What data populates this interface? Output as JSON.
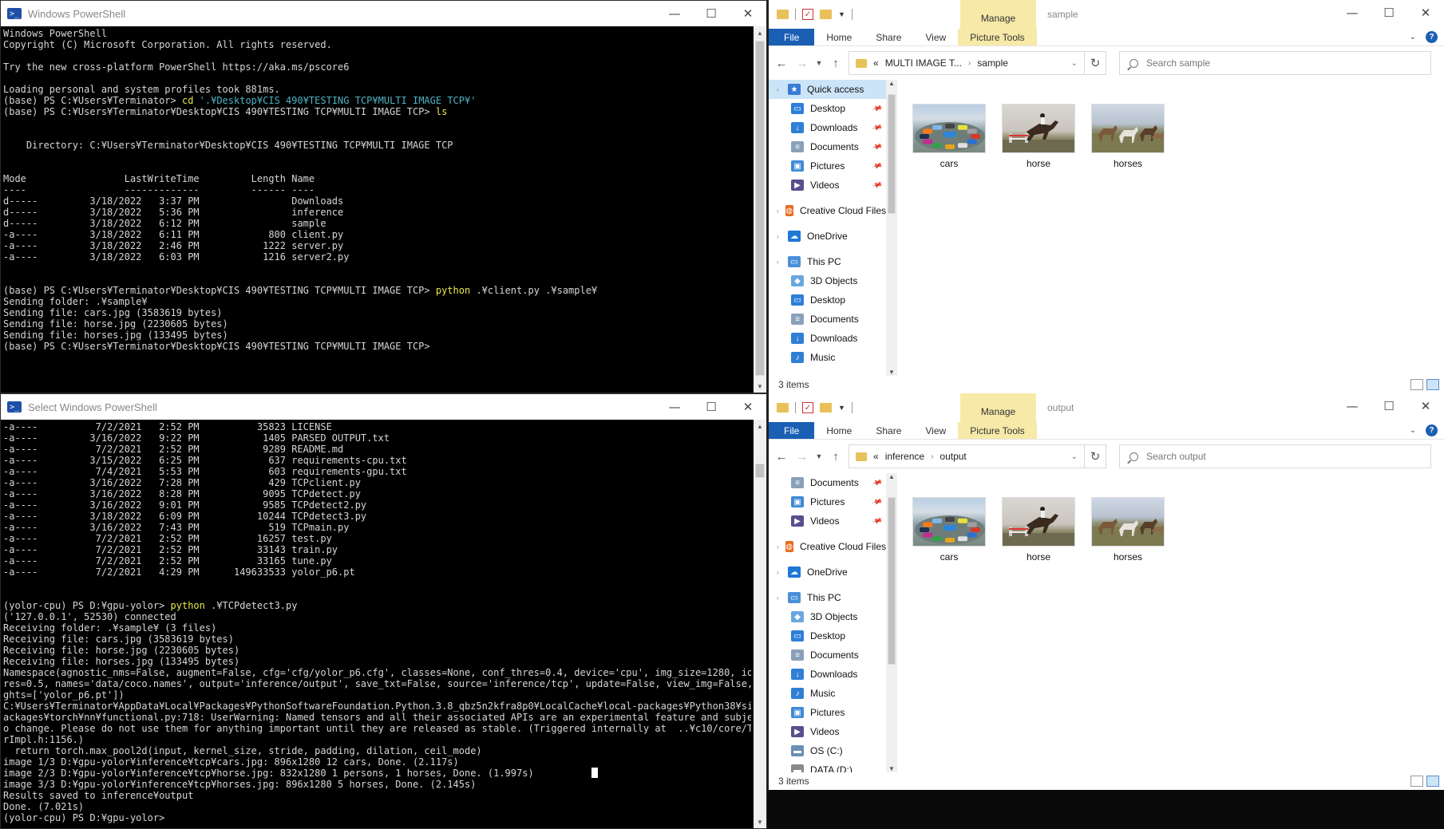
{
  "powershell_top": {
    "title": "Windows PowerShell",
    "lines": [
      [
        {
          "t": "Windows PowerShell",
          "c": "arg"
        }
      ],
      [
        {
          "t": "Copyright (C) Microsoft Corporation. All rights reserved.",
          "c": "arg"
        }
      ],
      [
        {
          "t": "",
          "c": "arg"
        }
      ],
      [
        {
          "t": "Try the new cross-platform PowerShell https://aka.ms/pscore6",
          "c": "arg"
        }
      ],
      [
        {
          "t": "",
          "c": "arg"
        }
      ],
      [
        {
          "t": "Loading personal and system profiles took 881ms.",
          "c": "arg"
        }
      ],
      [
        {
          "t": "(base) PS C:¥Users¥Terminator> ",
          "c": "arg"
        },
        {
          "t": "cd ",
          "c": "cmd"
        },
        {
          "t": "'.¥Desktop¥CIS 490¥TESTING TCP¥MULTI IMAGE TCP¥'",
          "c": "str"
        }
      ],
      [
        {
          "t": "(base) PS C:¥Users¥Terminator¥Desktop¥CIS 490¥TESTING TCP¥MULTI IMAGE TCP> ",
          "c": "arg"
        },
        {
          "t": "ls",
          "c": "cmd"
        }
      ],
      [
        {
          "t": "",
          "c": "arg"
        }
      ],
      [
        {
          "t": "",
          "c": "arg"
        }
      ],
      [
        {
          "t": "    Directory: C:¥Users¥Terminator¥Desktop¥CIS 490¥TESTING TCP¥MULTI IMAGE TCP",
          "c": "arg"
        }
      ],
      [
        {
          "t": "",
          "c": "arg"
        }
      ],
      [
        {
          "t": "",
          "c": "arg"
        }
      ],
      [
        {
          "t": "Mode                 LastWriteTime         Length Name",
          "c": "arg"
        }
      ],
      [
        {
          "t": "----                 -------------         ------ ----",
          "c": "arg"
        }
      ],
      [
        {
          "t": "d-----         3/18/2022   3:37 PM                Downloads",
          "c": "arg"
        }
      ],
      [
        {
          "t": "d-----         3/18/2022   5:36 PM                inference",
          "c": "arg"
        }
      ],
      [
        {
          "t": "d-----         3/18/2022   6:12 PM                sample",
          "c": "arg"
        }
      ],
      [
        {
          "t": "-a----         3/18/2022   6:11 PM            800 client.py",
          "c": "arg"
        }
      ],
      [
        {
          "t": "-a----         3/18/2022   2:46 PM           1222 server.py",
          "c": "arg"
        }
      ],
      [
        {
          "t": "-a----         3/18/2022   6:03 PM           1216 server2.py",
          "c": "arg"
        }
      ],
      [
        {
          "t": "",
          "c": "arg"
        }
      ],
      [
        {
          "t": "",
          "c": "arg"
        }
      ],
      [
        {
          "t": "(base) PS C:¥Users¥Terminator¥Desktop¥CIS 490¥TESTING TCP¥MULTI IMAGE TCP> ",
          "c": "arg"
        },
        {
          "t": "python",
          "c": "cmd"
        },
        {
          "t": " .¥client.py .¥sample¥",
          "c": "arg"
        }
      ],
      [
        {
          "t": "Sending folder: .¥sample¥",
          "c": "arg"
        }
      ],
      [
        {
          "t": "Sending file: cars.jpg (3583619 bytes)",
          "c": "arg"
        }
      ],
      [
        {
          "t": "Sending file: horse.jpg (2230605 bytes)",
          "c": "arg"
        }
      ],
      [
        {
          "t": "Sending file: horses.jpg (133495 bytes)",
          "c": "arg"
        }
      ],
      [
        {
          "t": "(base) PS C:¥Users¥Terminator¥Desktop¥CIS 490¥TESTING TCP¥MULTI IMAGE TCP>",
          "c": "arg"
        }
      ]
    ]
  },
  "powershell_bottom": {
    "title": "Select Windows PowerShell",
    "lines": [
      [
        {
          "t": "-a----          7/2/2021   2:52 PM          35823 LICENSE",
          "c": "arg"
        }
      ],
      [
        {
          "t": "-a----         3/16/2022   9:22 PM           1405 PARSED OUTPUT.txt",
          "c": "arg"
        }
      ],
      [
        {
          "t": "-a----          7/2/2021   2:52 PM           9289 README.md",
          "c": "arg"
        }
      ],
      [
        {
          "t": "-a----         3/15/2022   6:25 PM            637 requirements-cpu.txt",
          "c": "arg"
        }
      ],
      [
        {
          "t": "-a----          7/4/2021   5:53 PM            603 requirements-gpu.txt",
          "c": "arg"
        }
      ],
      [
        {
          "t": "-a----         3/16/2022   7:28 PM            429 TCPclient.py",
          "c": "arg"
        }
      ],
      [
        {
          "t": "-a----         3/16/2022   8:28 PM           9095 TCPdetect.py",
          "c": "arg"
        }
      ],
      [
        {
          "t": "-a----         3/16/2022   9:01 PM           9585 TCPdetect2.py",
          "c": "arg"
        }
      ],
      [
        {
          "t": "-a----         3/18/2022   6:09 PM          10244 TCPdetect3.py",
          "c": "arg"
        }
      ],
      [
        {
          "t": "-a----         3/16/2022   7:43 PM            519 TCPmain.py",
          "c": "arg"
        }
      ],
      [
        {
          "t": "-a----          7/2/2021   2:52 PM          16257 test.py",
          "c": "arg"
        }
      ],
      [
        {
          "t": "-a----          7/2/2021   2:52 PM          33143 train.py",
          "c": "arg"
        }
      ],
      [
        {
          "t": "-a----          7/2/2021   2:52 PM          33165 tune.py",
          "c": "arg"
        }
      ],
      [
        {
          "t": "-a----          7/2/2021   4:29 PM      149633533 yolor_p6.pt",
          "c": "arg"
        }
      ],
      [
        {
          "t": "",
          "c": "arg"
        }
      ],
      [
        {
          "t": "",
          "c": "arg"
        }
      ],
      [
        {
          "t": "(yolor-cpu) PS D:¥gpu-yolor> ",
          "c": "arg"
        },
        {
          "t": "python",
          "c": "cmd"
        },
        {
          "t": " .¥TCPdetect3.py",
          "c": "arg"
        }
      ],
      [
        {
          "t": "('127.0.0.1', 52530) connected",
          "c": "arg"
        }
      ],
      [
        {
          "t": "Receiving folder: .¥sample¥ (3 files)",
          "c": "arg"
        }
      ],
      [
        {
          "t": "Receiving file: cars.jpg (3583619 bytes)",
          "c": "arg"
        }
      ],
      [
        {
          "t": "Receiving file: horse.jpg (2230605 bytes)",
          "c": "arg"
        }
      ],
      [
        {
          "t": "Receiving file: horses.jpg (133495 bytes)",
          "c": "arg"
        }
      ],
      [
        {
          "t": "Namespace(agnostic_nms=False, augment=False, cfg='cfg/yolor_p6.cfg', classes=None, conf_thres=0.4, device='cpu', img_size=1280, iou_th",
          "c": "arg"
        }
      ],
      [
        {
          "t": "res=0.5, names='data/coco.names', output='inference/output', save_txt=False, source='inference/tcp', update=False, view_img=False, wei",
          "c": "arg"
        }
      ],
      [
        {
          "t": "ghts=['yolor_p6.pt'])",
          "c": "arg"
        }
      ],
      [
        {
          "t": "C:¥Users¥Terminator¥AppData¥Local¥Packages¥PythonSoftwareFoundation.Python.3.8_qbz5n2kfra8p0¥LocalCache¥local-packages¥Python38¥site-p",
          "c": "arg"
        }
      ],
      [
        {
          "t": "ackages¥torch¥nn¥functional.py:718: UserWarning: Named tensors and all their associated APIs are an experimental feature and subject t",
          "c": "arg"
        }
      ],
      [
        {
          "t": "o change. Please do not use them for anything important until they are released as stable. (Triggered internally at  ..¥c10/core/Tenso",
          "c": "arg"
        }
      ],
      [
        {
          "t": "rImpl.h:1156.)",
          "c": "arg"
        }
      ],
      [
        {
          "t": "  return torch.max_pool2d(input, kernel_size, stride, padding, dilation, ceil_mode)",
          "c": "arg"
        }
      ],
      [
        {
          "t": "image 1/3 D:¥gpu-yolor¥inference¥tcp¥cars.jpg: 896x1280 12 cars, Done. (2.117s)",
          "c": "arg"
        }
      ],
      [
        {
          "t": "image 2/3 D:¥gpu-yolor¥inference¥tcp¥horse.jpg: 832x1280 1 persons, 1 horses, Done. (1.997s)",
          "c": "arg"
        }
      ],
      [
        {
          "t": "image 3/3 D:¥gpu-yolor¥inference¥tcp¥horses.jpg: 896x1280 5 horses, Done. (2.145s)",
          "c": "arg"
        }
      ],
      [
        {
          "t": "Results saved to inference¥output",
          "c": "arg"
        }
      ],
      [
        {
          "t": "Done. (7.021s)",
          "c": "arg"
        }
      ],
      [
        {
          "t": "(yolor-cpu) PS D:¥gpu-yolor>",
          "c": "arg"
        }
      ]
    ]
  },
  "window_buttons": {
    "minimize": "—",
    "maximize": "☐",
    "close": "✕"
  },
  "explorer_top": {
    "title": "sample",
    "manage": "Manage",
    "tabs": [
      "File",
      "Home",
      "Share",
      "View",
      "Picture Tools"
    ],
    "breadcrumb": [
      "«",
      "MULTI IMAGE T...",
      "›",
      "sample"
    ],
    "search_placeholder": "Search sample",
    "nav": [
      {
        "label": "Quick access",
        "level": 0,
        "icon": "star-icon",
        "color": "#3a7bd5",
        "selected": true,
        "pin": false
      },
      {
        "label": "Desktop",
        "level": 1,
        "icon": "desktop-icon",
        "color": "#2f7fd6",
        "pin": true
      },
      {
        "label": "Downloads",
        "level": 1,
        "icon": "download-icon",
        "color": "#2f7fd6",
        "pin": true
      },
      {
        "label": "Documents",
        "level": 1,
        "icon": "document-icon",
        "color": "#8aa0b8",
        "pin": true
      },
      {
        "label": "Pictures",
        "level": 1,
        "icon": "picture-icon",
        "color": "#3f8ad6",
        "pin": true
      },
      {
        "label": "Videos",
        "level": 1,
        "icon": "video-icon",
        "color": "#5a4e8c",
        "pin": true
      },
      {
        "label": "Creative Cloud Files",
        "level": 0,
        "icon": "creative-cloud-icon",
        "color": "#e86a1a",
        "gap": true
      },
      {
        "label": "OneDrive",
        "level": 0,
        "icon": "onedrive-icon",
        "color": "#1e78d7",
        "gap": true
      },
      {
        "label": "This PC",
        "level": 0,
        "icon": "pc-icon",
        "color": "#4a90d9",
        "gap": true
      },
      {
        "label": "3D Objects",
        "level": 1,
        "icon": "3d-objects-icon",
        "color": "#6aa7e0"
      },
      {
        "label": "Desktop",
        "level": 1,
        "icon": "desktop-icon",
        "color": "#2f7fd6"
      },
      {
        "label": "Documents",
        "level": 1,
        "icon": "document-icon",
        "color": "#8aa0b8"
      },
      {
        "label": "Downloads",
        "level": 1,
        "icon": "download-icon",
        "color": "#2f7fd6"
      },
      {
        "label": "Music",
        "level": 1,
        "icon": "music-icon",
        "color": "#2f7fd6"
      }
    ],
    "files": [
      {
        "name": "cars",
        "kind": "cars"
      },
      {
        "name": "horse",
        "kind": "horse"
      },
      {
        "name": "horses",
        "kind": "horses"
      }
    ],
    "status": "3 items"
  },
  "explorer_bottom": {
    "title": "output",
    "manage": "Manage",
    "tabs": [
      "File",
      "Home",
      "Share",
      "View",
      "Picture Tools"
    ],
    "breadcrumb": [
      "«",
      "inference",
      "›",
      "output"
    ],
    "search_placeholder": "Search output",
    "nav": [
      {
        "label": "Documents",
        "level": 1,
        "icon": "document-icon",
        "color": "#8aa0b8",
        "pin": true
      },
      {
        "label": "Pictures",
        "level": 1,
        "icon": "picture-icon",
        "color": "#3f8ad6",
        "pin": true
      },
      {
        "label": "Videos",
        "level": 1,
        "icon": "video-icon",
        "color": "#5a4e8c",
        "pin": true
      },
      {
        "label": "Creative Cloud Files",
        "level": 0,
        "icon": "creative-cloud-icon",
        "color": "#e86a1a",
        "gap": true
      },
      {
        "label": "OneDrive",
        "level": 0,
        "icon": "onedrive-icon",
        "color": "#1e78d7",
        "gap": true
      },
      {
        "label": "This PC",
        "level": 0,
        "icon": "pc-icon",
        "color": "#4a90d9",
        "gap": true
      },
      {
        "label": "3D Objects",
        "level": 1,
        "icon": "3d-objects-icon",
        "color": "#6aa7e0"
      },
      {
        "label": "Desktop",
        "level": 1,
        "icon": "desktop-icon",
        "color": "#2f7fd6"
      },
      {
        "label": "Documents",
        "level": 1,
        "icon": "document-icon",
        "color": "#8aa0b8"
      },
      {
        "label": "Downloads",
        "level": 1,
        "icon": "download-icon",
        "color": "#2f7fd6"
      },
      {
        "label": "Music",
        "level": 1,
        "icon": "music-icon",
        "color": "#2f7fd6"
      },
      {
        "label": "Pictures",
        "level": 1,
        "icon": "picture-icon",
        "color": "#3f8ad6"
      },
      {
        "label": "Videos",
        "level": 1,
        "icon": "video-icon",
        "color": "#5a4e8c"
      },
      {
        "label": "OS (C:)",
        "level": 1,
        "icon": "drive-icon",
        "color": "#6b8fb5"
      },
      {
        "label": "DATA (D:)",
        "level": 1,
        "icon": "drive-icon",
        "color": "#8a8a8a"
      }
    ],
    "files": [
      {
        "name": "cars",
        "kind": "cars"
      },
      {
        "name": "horse",
        "kind": "horse"
      },
      {
        "name": "horses",
        "kind": "horses"
      }
    ],
    "status": "3 items"
  },
  "colors": {
    "ps_text": "#d6d6d6",
    "ps_command": "#e8e84a",
    "ps_string": "#4fb3c4",
    "explorer_accent": "#1a5fb4",
    "manage_highlight": "#f7e9a7",
    "nav_selected": "#cce4f7"
  }
}
